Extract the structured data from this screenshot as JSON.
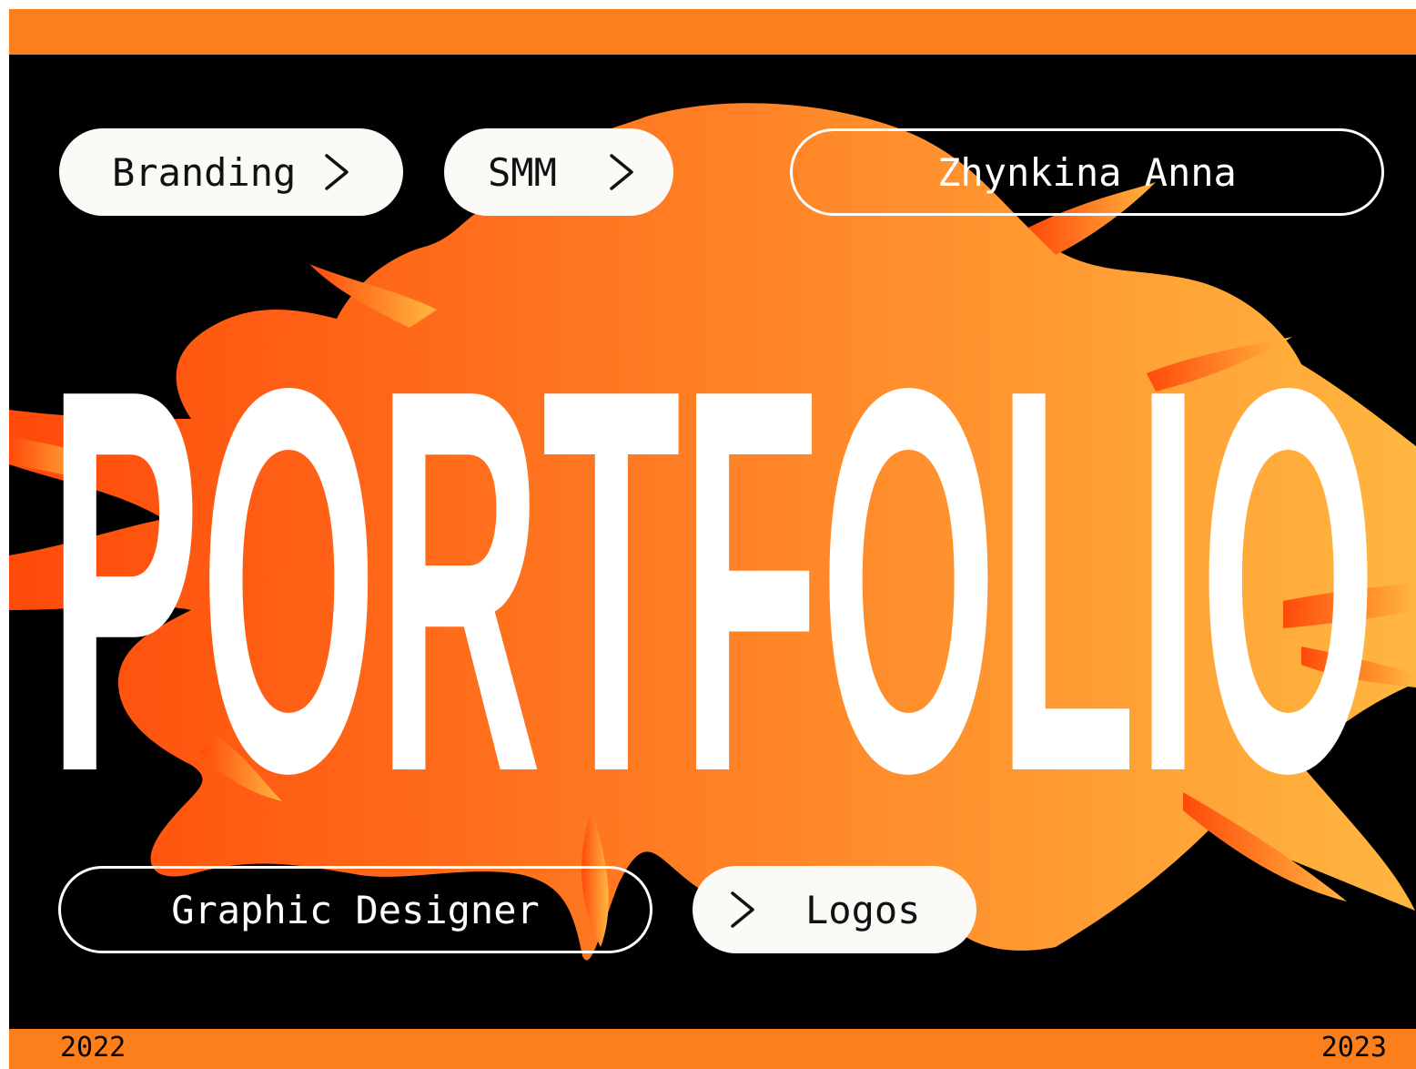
{
  "colors": {
    "accent_orange": "#fd7f1c",
    "background": "#000000",
    "splash_start": "#ff4a0a",
    "splash_end": "#ffb640",
    "pill_fill": "#fbfaf6",
    "text_white": "#ffffff"
  },
  "title": "PORTFOLIO",
  "tags": {
    "branding": "Branding",
    "smm": "SMM",
    "logos": "Logos"
  },
  "author_name": "Zhynkina Anna",
  "role": "Graphic Designer",
  "years": {
    "start": "2022",
    "end": "2023"
  },
  "icons": {
    "chevron": "chevron-right-icon"
  }
}
